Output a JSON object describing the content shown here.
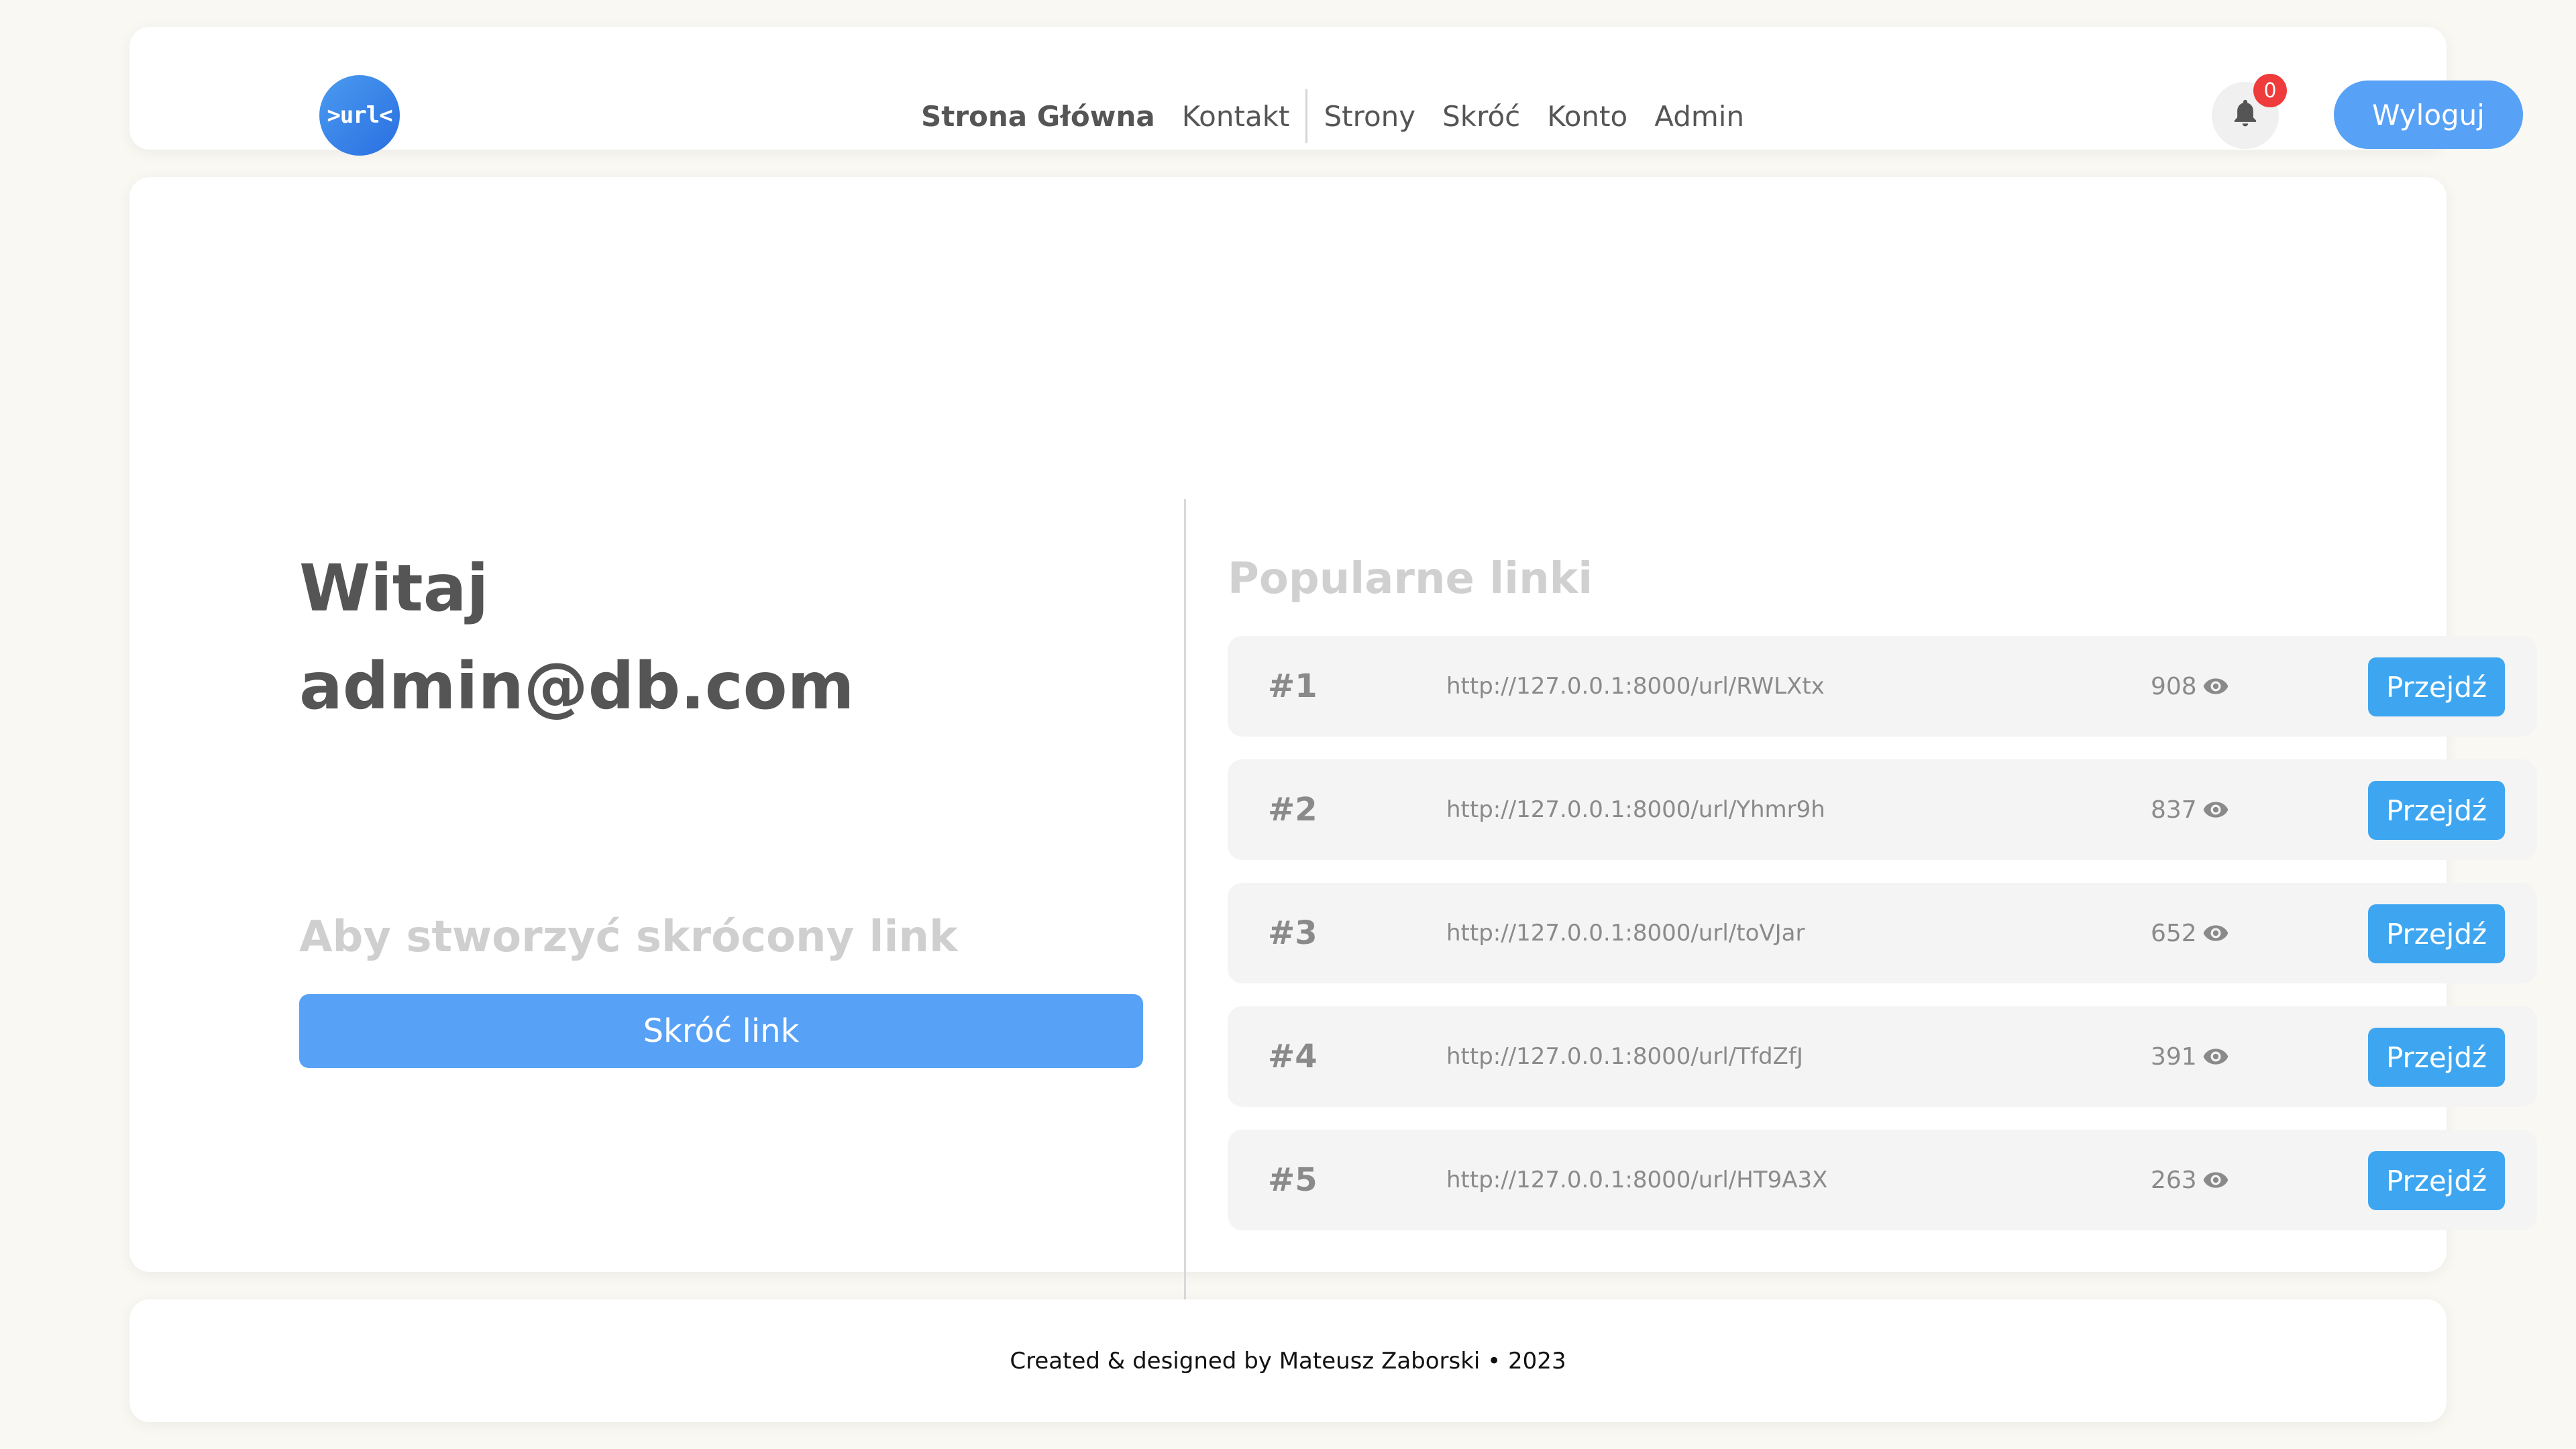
{
  "header": {
    "logo_text": ">url<",
    "nav": [
      {
        "label": "Strona Główna"
      },
      {
        "label": "Kontakt"
      },
      {
        "label": "Strony"
      },
      {
        "label": "Skróć"
      },
      {
        "label": "Konto"
      },
      {
        "label": "Admin"
      }
    ],
    "notification_count": "0",
    "logout_label": "Wyloguj"
  },
  "welcome": {
    "greeting": "Witaj",
    "email": "admin@db.com",
    "subtitle": "Aby stworzyć skrócony link",
    "shorten_button": "Skróć link"
  },
  "popular": {
    "title": "Popularne linki",
    "links": [
      {
        "rank": "#1",
        "url": "http://127.0.0.1:8000/url/RWLXtx",
        "views": "908",
        "button": "Przejdź"
      },
      {
        "rank": "#2",
        "url": "http://127.0.0.1:8000/url/Yhmr9h",
        "views": "837",
        "button": "Przejdź"
      },
      {
        "rank": "#3",
        "url": "http://127.0.0.1:8000/url/toVJar",
        "views": "652",
        "button": "Przejdź"
      },
      {
        "rank": "#4",
        "url": "http://127.0.0.1:8000/url/TfdZfJ",
        "views": "391",
        "button": "Przejdź"
      },
      {
        "rank": "#5",
        "url": "http://127.0.0.1:8000/url/HT9A3X",
        "views": "263",
        "button": "Przejdź"
      }
    ]
  },
  "footer": {
    "credits": "Created & designed by Mateusz Zaborski • 2023"
  },
  "colors": {
    "accent": "#57a1f6",
    "go_button": "#3ea6f0",
    "badge": "#ef3b3b",
    "background": "#faf8f3"
  }
}
